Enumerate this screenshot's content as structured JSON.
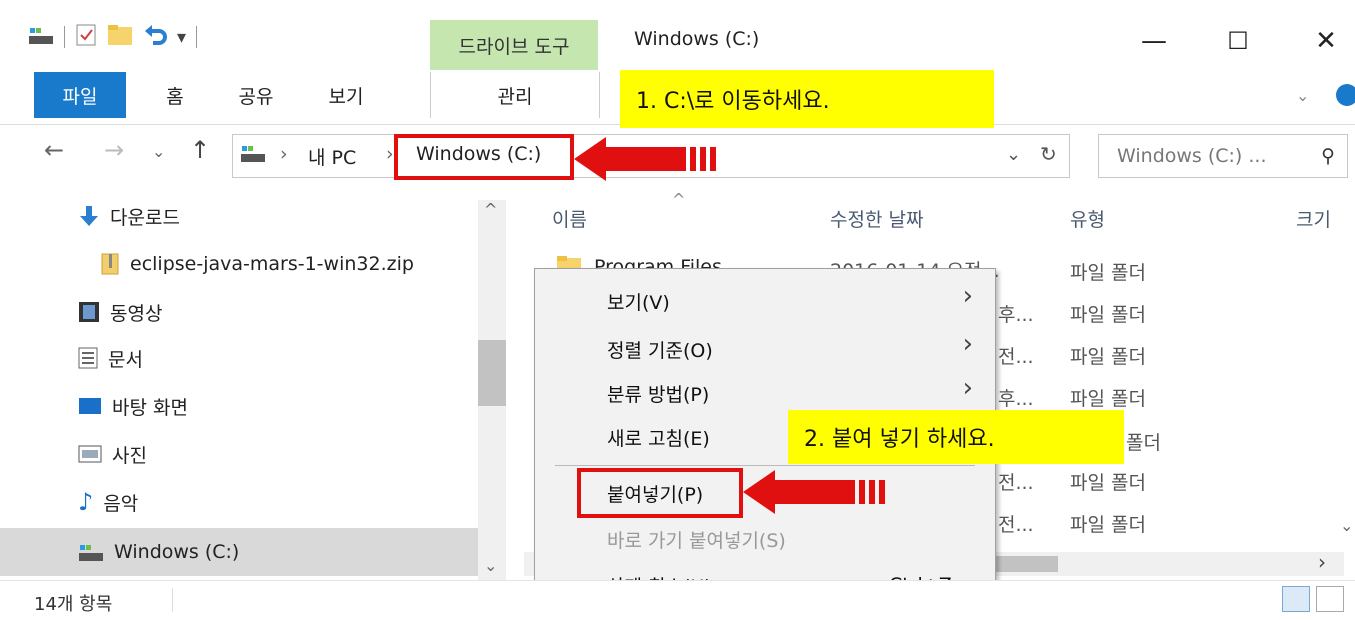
{
  "window": {
    "title": "Windows (C:)",
    "context_tab": "드라이브 도구",
    "minimize": "—",
    "maximize": "☐",
    "close": "✕"
  },
  "ribbon": {
    "tabs": [
      "파일",
      "홈",
      "공유",
      "보기",
      "관리"
    ]
  },
  "address": {
    "crumbs": [
      "내 PC",
      "Windows (C:)"
    ],
    "search_placeholder": "Windows (C:) ...",
    "separator": "›"
  },
  "nav": {
    "items": [
      {
        "label": "다운로드",
        "icon": "download-icon"
      },
      {
        "label": "eclipse-java-mars-1-win32.zip",
        "icon": "zip-icon"
      },
      {
        "label": "동영상",
        "icon": "video-icon"
      },
      {
        "label": "문서",
        "icon": "document-icon"
      },
      {
        "label": "바탕 화면",
        "icon": "desktop-icon"
      },
      {
        "label": "사진",
        "icon": "picture-icon"
      },
      {
        "label": "음악",
        "icon": "music-icon"
      },
      {
        "label": "Windows (C:)",
        "icon": "drive-icon"
      }
    ]
  },
  "files": {
    "columns": [
      "이름",
      "수정한 날짜",
      "유형",
      "크기"
    ],
    "first_row": {
      "name": "Program Files",
      "date": "2016-01-14 오전..."
    },
    "date_fragments": [
      "후...",
      "전...",
      "후...",
      "",
      "전...",
      "전..."
    ],
    "type": "파일 폴더",
    "type_rows": [
      "파일 폴더",
      "파일 폴더",
      "파일 폴더",
      "파일 폴더",
      "폴더",
      "파일 폴더",
      "파일 폴더"
    ]
  },
  "context_menu": {
    "items": [
      {
        "label": "보기(V)",
        "submenu": true
      },
      {
        "label": "정렬 기준(O)",
        "submenu": true
      },
      {
        "label": "분류 방법(P)",
        "submenu": true
      },
      {
        "label": "새로 고침(E)"
      },
      {
        "label": "붙여넣기(P)"
      },
      {
        "label": "바로 가기 붙여넣기(S)",
        "disabled": true
      },
      {
        "label": "삭제 취소(U)",
        "shortcut": "Ctrl+Z"
      }
    ]
  },
  "annotations": {
    "step1": "1.  C:\\로 이동하세요.",
    "step2": "2. 붙여 넣기 하세요."
  },
  "status": {
    "count": "14개 항목"
  },
  "colors": {
    "file_tab": "#1979ca",
    "drive_tools": "#c6e6b0",
    "highlight_box": "#e01010",
    "annotation_bg": "#ffff00"
  }
}
